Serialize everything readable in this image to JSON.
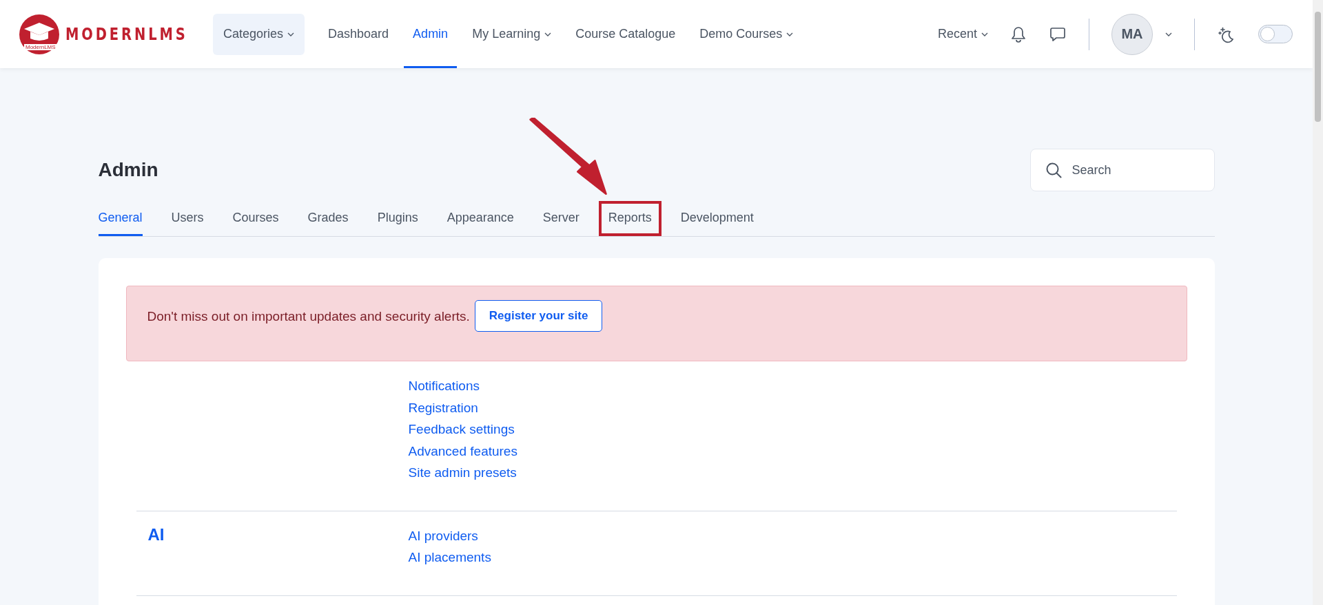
{
  "header": {
    "logo": {
      "badge_text": "ModernLMS",
      "wordmark": "MODERNLMS"
    },
    "nav": [
      {
        "label": "Categories",
        "dropdown": true,
        "selected": false,
        "kind": "button"
      },
      {
        "label": "Dashboard",
        "dropdown": false,
        "selected": false,
        "kind": "link"
      },
      {
        "label": "Admin",
        "dropdown": false,
        "selected": true,
        "kind": "link"
      },
      {
        "label": "My Learning",
        "dropdown": true,
        "selected": false,
        "kind": "link"
      },
      {
        "label": "Course Catalogue",
        "dropdown": false,
        "selected": false,
        "kind": "link"
      },
      {
        "label": "Demo Courses",
        "dropdown": true,
        "selected": false,
        "kind": "link"
      }
    ],
    "recent": {
      "label": "Recent"
    },
    "user": {
      "initials": "MA"
    },
    "dark_mode": {
      "on": false
    }
  },
  "page": {
    "title": "Admin",
    "search": {
      "placeholder": "Search"
    },
    "tabs": [
      {
        "label": "General",
        "selected": true,
        "highlighted": false
      },
      {
        "label": "Users",
        "selected": false,
        "highlighted": false
      },
      {
        "label": "Courses",
        "selected": false,
        "highlighted": false
      },
      {
        "label": "Grades",
        "selected": false,
        "highlighted": false
      },
      {
        "label": "Plugins",
        "selected": false,
        "highlighted": false
      },
      {
        "label": "Appearance",
        "selected": false,
        "highlighted": false
      },
      {
        "label": "Server",
        "selected": false,
        "highlighted": false
      },
      {
        "label": "Reports",
        "selected": false,
        "highlighted": true
      },
      {
        "label": "Development",
        "selected": false,
        "highlighted": false
      }
    ],
    "alert": {
      "message": "Don't miss out on important updates and security alerts.",
      "button": "Register your site"
    },
    "sections": [
      {
        "links": [
          "Notifications",
          "Registration",
          "Feedback settings",
          "Advanced features",
          "Site admin presets"
        ]
      },
      {
        "heading": "AI",
        "links": [
          "AI providers",
          "AI placements"
        ]
      }
    ]
  }
}
